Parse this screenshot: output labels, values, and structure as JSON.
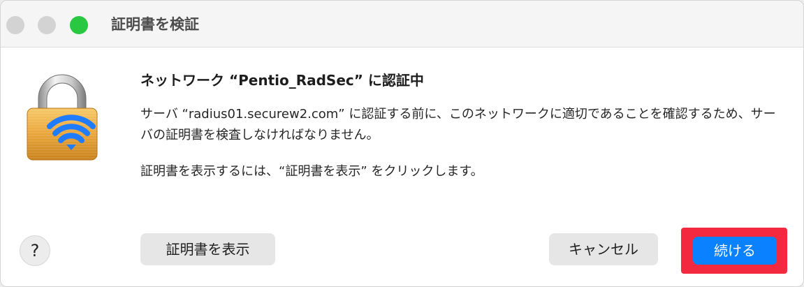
{
  "window": {
    "title": "証明書を検証",
    "traffic_light_colors": {
      "close": "#d3d3d3",
      "minimize": "#d3d3d3",
      "zoom": "#29c840"
    }
  },
  "dialog": {
    "icon": "wifi-lock-icon",
    "heading": "ネットワーク “Pentio_RadSec” に認証中",
    "message_line_1": "サーバ “radius01.securew2.com” に認証する前に、このネットワークに適切であることを確認するため、サーバの証明書を検査しなければなりません。",
    "message_line_2": "証明書を表示するには、“証明書を表示” をクリックします。"
  },
  "buttons": {
    "help_label": "?",
    "show_certificate_label": "証明書を表示",
    "cancel_label": "キャンセル",
    "continue_label": "続ける"
  },
  "colors": {
    "accent": "#0a82ff",
    "highlight": "#f2293f"
  }
}
